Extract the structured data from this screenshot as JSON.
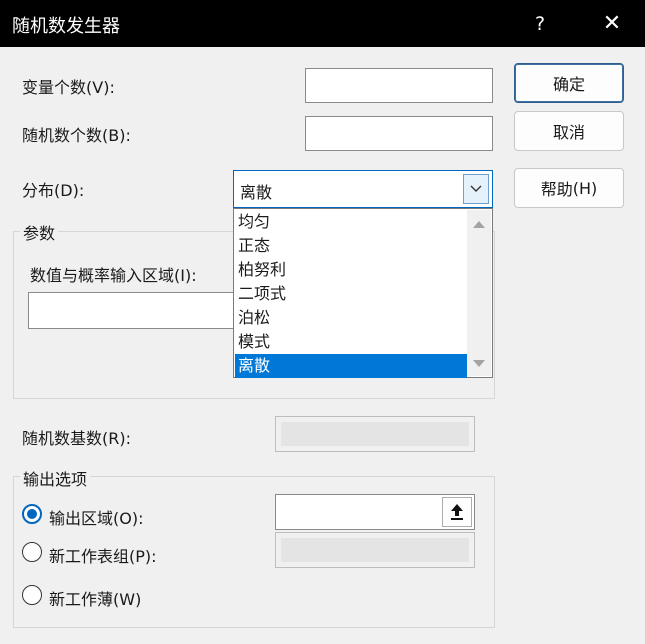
{
  "window": {
    "title": "随机数发生器",
    "help_glyph": "?",
    "close_glyph": "✕"
  },
  "fields": {
    "var_count": {
      "label": "变量个数",
      "key_hint": "(V):",
      "access_key": "V",
      "value": ""
    },
    "num_count": {
      "label": "随机数个数",
      "key_hint": "(B):",
      "access_key": "B",
      "value": ""
    },
    "distribution": {
      "label": "分布",
      "key_hint": "(D):",
      "access_key": "D",
      "value": "离散"
    },
    "seed": {
      "label": "随机数基数",
      "key_hint": "(R):",
      "access_key": "R",
      "value": ""
    }
  },
  "buttons": {
    "ok": "确定",
    "cancel": "取消",
    "help": "帮助",
    "help_key_hint": "(H)"
  },
  "params": {
    "group_title": "参数",
    "range_label": "数值与概率输入区域",
    "range_key_hint": "(I):",
    "range_value": ""
  },
  "dropdown": {
    "items": [
      "均匀",
      "正态",
      "柏努利",
      "二项式",
      "泊松",
      "模式",
      "离散"
    ],
    "selected_index": 6
  },
  "output": {
    "group_title": "输出选项",
    "options": [
      {
        "label": "输出区域",
        "key_hint": "(O):",
        "checked": true
      },
      {
        "label": "新工作表组",
        "key_hint": "(P):",
        "checked": false
      },
      {
        "label": "新工作薄",
        "key_hint": "(W)",
        "checked": false
      }
    ]
  }
}
